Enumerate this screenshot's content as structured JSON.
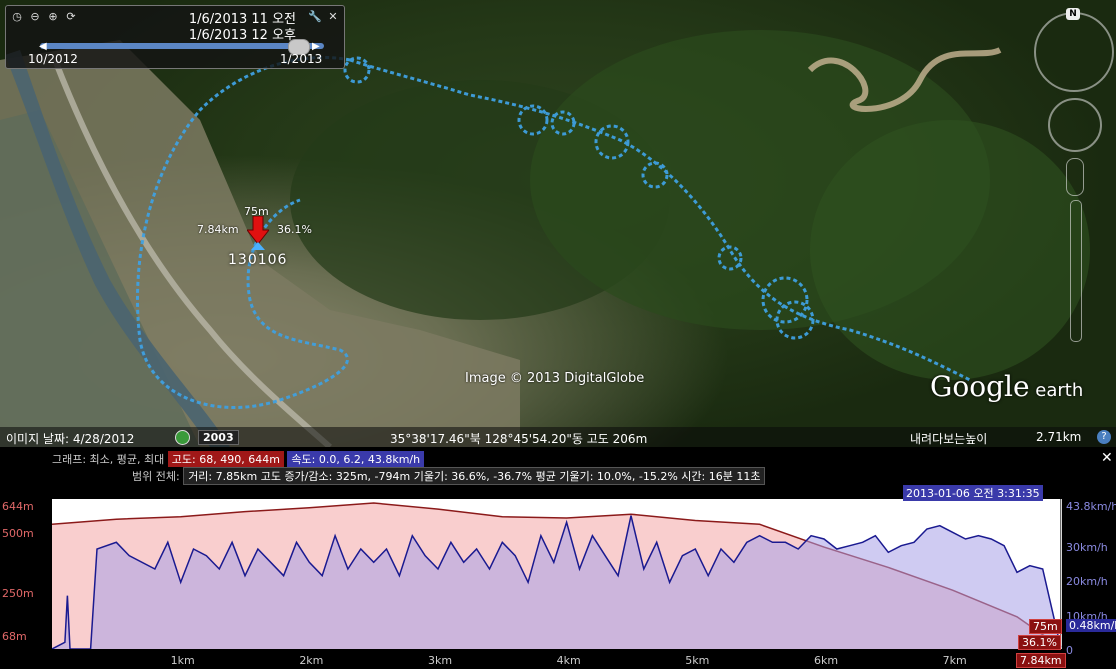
{
  "time_slider": {
    "start_datetime": "1/6/2013  11 오전",
    "end_datetime": "1/6/2013  12 오후",
    "range_start": "10/2012",
    "range_end": "1/2013",
    "icons": [
      "clock-icon",
      "zoom-out-icon",
      "zoom-in-icon",
      "play-icon",
      "wrench-icon",
      "close-icon"
    ]
  },
  "map": {
    "attribution": "Image © 2013 DigitalGlobe",
    "logo_main": "Google",
    "logo_sub": " earth",
    "north_label": "N",
    "pointer": {
      "elevation": "75m",
      "distance": "7.84km",
      "percent": "36.1%",
      "name": "130106"
    }
  },
  "status_bar": {
    "image_date": "이미지 날짜: 4/28/2012",
    "year_badge": "2003",
    "coordinates": "35°38'17.46\"북 128°45'54.20\"동 고도   206m",
    "eye_alt_label": "내려다보는높이",
    "eye_alt_value": "2.71km"
  },
  "profile_panel": {
    "graph_label": "그래프: 최소, 평균, 최대",
    "elev_stats": "고도: 68, 490, 644m",
    "speed_stats": "속도: 0.0, 6.2, 43.8km/h",
    "range_label": "범위 전체:",
    "range_stats": "거리: 7.85km 고도 증가/감소: 325m, -794m 기울기: 36.6%, -36.7% 평균 기울기: 10.0%, -15.2% 시간: 16분 11초",
    "cursor_datetime": "2013-01-06 오전 3:31:35",
    "cursor_elevation": "75m",
    "cursor_percent": "36.1%",
    "cursor_distance": "7.84km",
    "cursor_speed": "0.48km/h",
    "left_axis": [
      "644m",
      "500m",
      "250m",
      "68m"
    ],
    "right_axis": [
      "43.8km/h",
      "30km/h",
      "20km/h",
      "10km/h",
      "0"
    ],
    "x_ticks": [
      "1km",
      "2km",
      "3km",
      "4km",
      "5km",
      "6km",
      "7km"
    ]
  },
  "chart_data": {
    "type": "line",
    "xlabel": "",
    "ylabel": "",
    "x_unit": "km",
    "xlim": [
      0,
      7.85
    ],
    "series": [
      {
        "color": "#8b1a1a",
        "fill": "#f4a6a6",
        "axis": "left",
        "ylim": [
          68,
          644
        ],
        "x": [
          0,
          0.5,
          1.0,
          1.5,
          2.0,
          2.5,
          3.0,
          3.5,
          4.0,
          4.5,
          5.0,
          5.5,
          6.0,
          6.5,
          7.0,
          7.5,
          7.84
        ],
        "values": [
          560,
          580,
          590,
          610,
          625,
          644,
          620,
          590,
          585,
          600,
          575,
          560,
          470,
          390,
          300,
          195,
          75
        ]
      },
      {
        "color": "#1a1a90",
        "fill": "#a7a0e8",
        "axis": "right",
        "ylim": [
          0,
          43.8
        ],
        "x": [
          0,
          0.1,
          0.12,
          0.14,
          0.3,
          0.35,
          0.5,
          0.6,
          0.8,
          0.9,
          1.0,
          1.1,
          1.2,
          1.3,
          1.4,
          1.5,
          1.6,
          1.7,
          1.8,
          1.9,
          2.0,
          2.1,
          2.2,
          2.3,
          2.4,
          2.5,
          2.6,
          2.7,
          2.8,
          2.9,
          3.0,
          3.1,
          3.2,
          3.3,
          3.4,
          3.5,
          3.6,
          3.7,
          3.8,
          3.9,
          4.0,
          4.1,
          4.2,
          4.3,
          4.4,
          4.5,
          4.6,
          4.7,
          4.8,
          4.9,
          5.0,
          5.1,
          5.2,
          5.3,
          5.4,
          5.5,
          5.6,
          5.7,
          5.8,
          5.9,
          6.0,
          6.1,
          6.2,
          6.3,
          6.4,
          6.5,
          6.6,
          6.7,
          6.8,
          6.9,
          7.0,
          7.1,
          7.2,
          7.3,
          7.4,
          7.5,
          7.6,
          7.7,
          7.84
        ],
        "values": [
          0,
          2,
          16,
          0,
          0,
          30,
          32,
          28,
          24,
          32,
          20,
          30,
          28,
          24,
          32,
          22,
          30,
          26,
          22,
          32,
          26,
          22,
          34,
          24,
          30,
          26,
          30,
          22,
          34,
          28,
          24,
          32,
          26,
          30,
          24,
          32,
          28,
          20,
          34,
          26,
          38,
          24,
          34,
          28,
          22,
          40,
          24,
          32,
          20,
          28,
          30,
          22,
          30,
          26,
          32,
          34,
          32,
          32,
          30,
          34,
          33,
          30,
          31,
          32,
          34,
          29,
          31,
          32,
          36,
          37,
          35,
          33,
          34,
          33,
          31,
          23,
          25,
          24,
          0.5
        ]
      }
    ]
  }
}
